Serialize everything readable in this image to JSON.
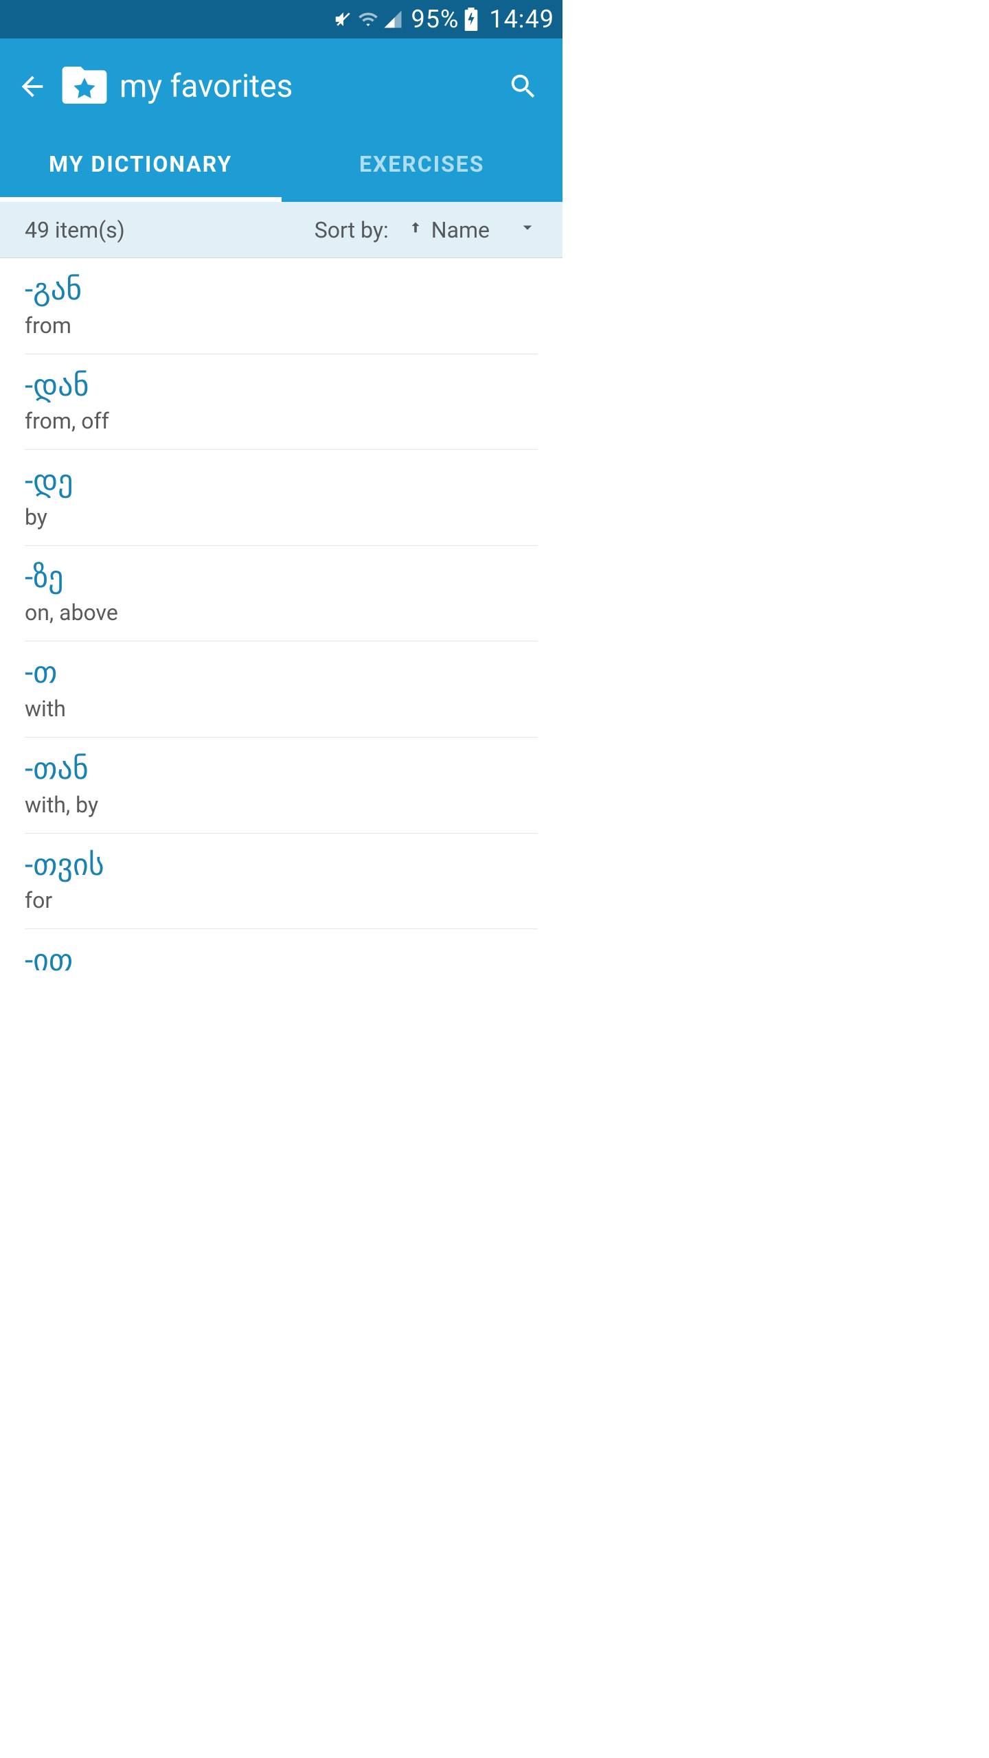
{
  "status": {
    "battery_pct": "95%",
    "time": "14:49"
  },
  "appbar": {
    "title": "my favorites"
  },
  "tabs": {
    "dictionary": "MY DICTIONARY",
    "exercises": "EXERCISES"
  },
  "sortbar": {
    "count": "49 item(s)",
    "sort_by_label": "Sort by:",
    "field": "Name"
  },
  "items": [
    {
      "word": "-გან",
      "trans": "from"
    },
    {
      "word": "-დან",
      "trans": "from, off"
    },
    {
      "word": "-დე",
      "trans": "by"
    },
    {
      "word": "-ზე",
      "trans": "on, above"
    },
    {
      "word": "-თ",
      "trans": "with"
    },
    {
      "word": "-თან",
      "trans": "with, by"
    },
    {
      "word": "-თვის",
      "trans": "for"
    },
    {
      "word": "-ით",
      "trans": ""
    }
  ]
}
